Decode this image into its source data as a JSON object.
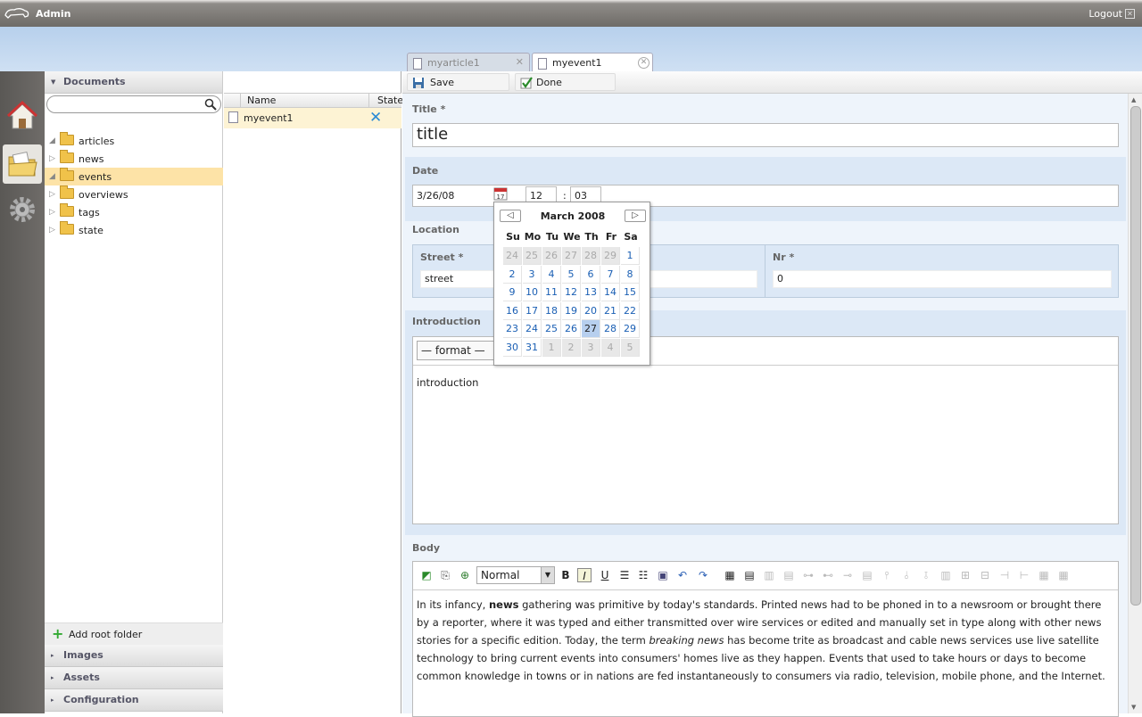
{
  "topbar": {
    "title": "Admin",
    "logout": "Logout"
  },
  "tabs": [
    {
      "label": "myarticle1"
    },
    {
      "label": "myevent1"
    }
  ],
  "sidebar": {
    "documents": "Documents",
    "tree": [
      {
        "label": "articles",
        "expanded": true
      },
      {
        "label": "news",
        "expanded": false
      },
      {
        "label": "events",
        "expanded": true,
        "selected": true
      },
      {
        "label": "overviews",
        "expanded": false
      },
      {
        "label": "tags",
        "expanded": false
      },
      {
        "label": "state",
        "expanded": false
      }
    ],
    "add_root": "Add root folder",
    "sections": [
      "Images",
      "Assets",
      "Configuration"
    ]
  },
  "list": {
    "col_name": "Name",
    "col_state": "State",
    "rows": [
      {
        "name": "myevent1"
      }
    ]
  },
  "toolbar": {
    "save": "Save",
    "done": "Done"
  },
  "form": {
    "title_label": "Title *",
    "title_value": "title",
    "date_label": "Date",
    "date_value": "3/26/08",
    "hour": "12",
    "colon": ":",
    "minute": "03",
    "location_label": "Location",
    "street_label": "Street *",
    "street_value": "street",
    "nr_label": "Nr *",
    "nr_value": "0",
    "intro_label": "Introduction",
    "intro_format": "— format —",
    "intro_text": "introduction",
    "body_label": "Body",
    "body_style": "Normal",
    "body_text": {
      "p1": "In its infancy, ",
      "b": "news",
      "p2": " gathering was primitive by today's standards. Printed news had to be phoned in to a newsroom or brought there by a reporter, where it was typed and either transmitted over wire services or edited and manually set in type along with other news stories for a specific edition. Today, the term ",
      "i": "breaking news",
      "p3": " has become trite as broadcast and cable news services use live satellite technology to bring current events into consumers' homes live as they happen. Events that used to take hours or days to become common knowledge in towns or in nations are fed instantaneously to consumers via radio, television, mobile phone, and the Internet."
    }
  },
  "calendar": {
    "month": "March 2008",
    "weekdays": [
      "Su",
      "Mo",
      "Tu",
      "We",
      "Th",
      "Fr",
      "Sa"
    ],
    "days": [
      "24",
      "25",
      "26",
      "27",
      "28",
      "29",
      "1",
      "2",
      "3",
      "4",
      "5",
      "6",
      "7",
      "8",
      "9",
      "10",
      "11",
      "12",
      "13",
      "14",
      "15",
      "16",
      "17",
      "18",
      "19",
      "20",
      "21",
      "22",
      "23",
      "24",
      "25",
      "26",
      "27",
      "28",
      "29",
      "30",
      "31",
      "1",
      "2",
      "3",
      "4",
      "5"
    ],
    "other_month": [
      0,
      1,
      2,
      3,
      4,
      5,
      37,
      38,
      39,
      40,
      41
    ],
    "today_index": 32
  }
}
